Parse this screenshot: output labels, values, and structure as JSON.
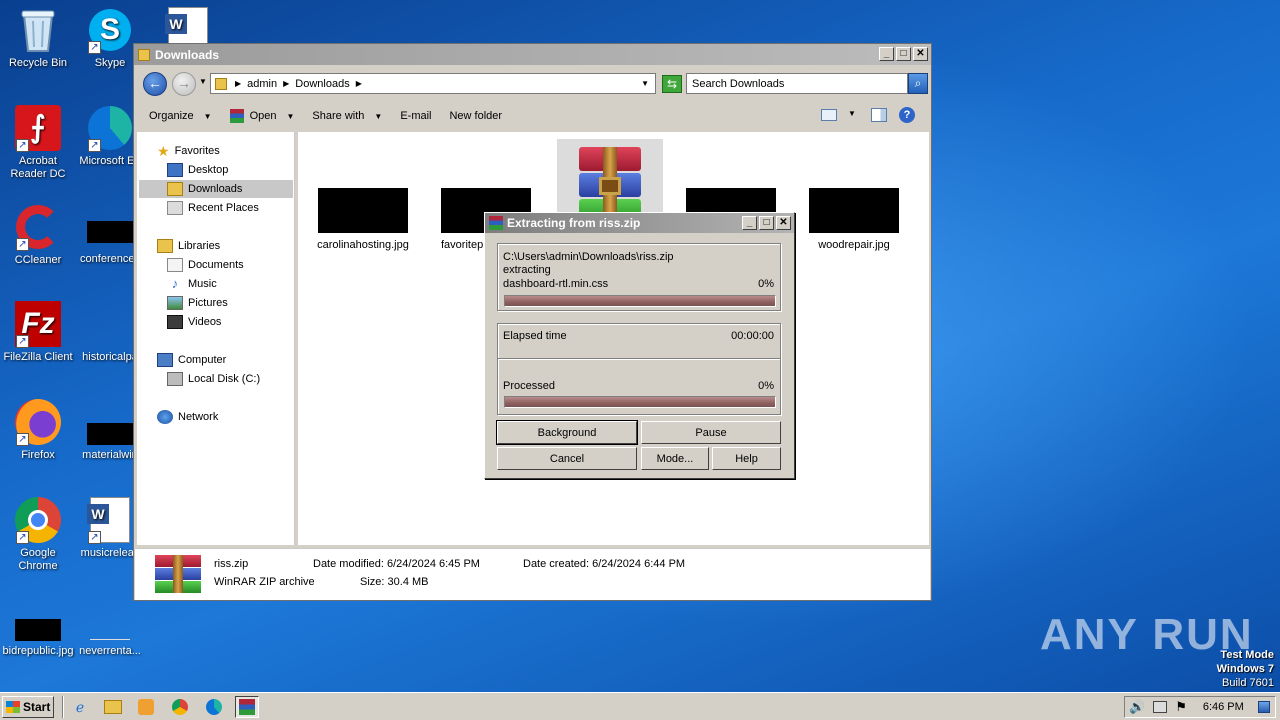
{
  "desktop": {
    "icons": [
      {
        "label": "Recycle Bin",
        "icon": "recycle-bin-icon"
      },
      {
        "label": "Skype",
        "icon": "skype-icon"
      },
      {
        "label": "Acrobat Reader DC",
        "icon": "acrobat-icon"
      },
      {
        "label": "Microsoft Ed",
        "icon": "edge-icon"
      },
      {
        "label": "CCleaner",
        "icon": "ccleaner-icon"
      },
      {
        "label": "conferencec",
        "icon": "image-file-icon"
      },
      {
        "label": "FileZilla Client",
        "icon": "filezilla-icon"
      },
      {
        "label": "historicalpa",
        "icon": "image-file-icon"
      },
      {
        "label": "Firefox",
        "icon": "firefox-icon"
      },
      {
        "label": "materialwin",
        "icon": "image-file-icon"
      },
      {
        "label": "Google Chrome",
        "icon": "chrome-icon"
      },
      {
        "label": "musicreleas",
        "icon": "word-doc-icon"
      },
      {
        "label": "bidrepublic.jpg",
        "icon": "image-file-icon"
      },
      {
        "label": "neverrenta...",
        "icon": "file-icon"
      }
    ],
    "watermark": "ANY RUN",
    "test_mode": [
      "Test Mode",
      "Windows 7",
      "Build 7601"
    ]
  },
  "explorer": {
    "title": "Downloads",
    "breadcrumb": [
      "admin",
      "Downloads"
    ],
    "search_placeholder": "Search Downloads",
    "toolbar": {
      "organize": "Organize",
      "open": "Open",
      "share_with": "Share with",
      "email": "E-mail",
      "new_folder": "New folder"
    },
    "nav": {
      "favorites": "Favorites",
      "desktop": "Desktop",
      "downloads": "Downloads",
      "recent_places": "Recent Places",
      "libraries": "Libraries",
      "documents": "Documents",
      "music": "Music",
      "pictures": "Pictures",
      "videos": "Videos",
      "computer": "Computer",
      "local_disk": "Local Disk (C:)",
      "network": "Network"
    },
    "files": [
      {
        "name": "carolinahosting.jpg"
      },
      {
        "name": "favoritep"
      },
      {
        "name": "riss.zip"
      },
      {
        "name": ""
      },
      {
        "name": "woodrepair.jpg"
      }
    ],
    "details": {
      "name": "riss.zip",
      "type": "WinRAR ZIP archive",
      "modified_label": "Date modified:",
      "modified_value": "6/24/2024 6:45 PM",
      "size_label": "Size:",
      "size_value": "30.4 MB",
      "created_label": "Date created:",
      "created_value": "6/24/2024 6:44 PM"
    }
  },
  "dialog": {
    "title": "Extracting from riss.zip",
    "path": "C:\\Users\\admin\\Downloads\\riss.zip",
    "action": "extracting",
    "current_file": "dashboard-rtl.min.css",
    "file_percent": "0%",
    "file_progress": 1.0,
    "elapsed_label": "Elapsed time",
    "elapsed_value": "00:00:00",
    "processed_label": "Processed",
    "processed_percent": "0%",
    "buttons": {
      "background": "Background",
      "pause": "Pause",
      "cancel": "Cancel",
      "mode": "Mode...",
      "help": "Help"
    }
  },
  "taskbar": {
    "start": "Start",
    "clock": "6:46 PM"
  }
}
